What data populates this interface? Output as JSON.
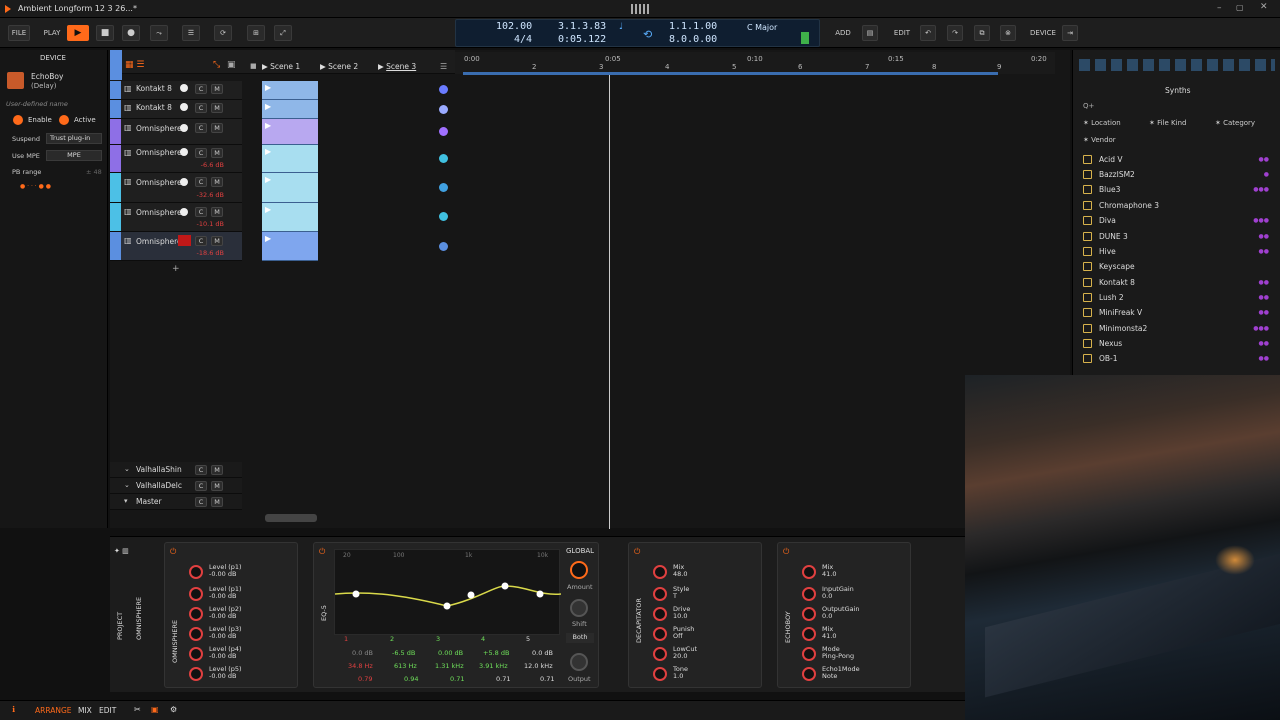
{
  "title": "Ambient Longform 12 3 26...*",
  "toolbar": {
    "file": "FILE",
    "play": "PLAY",
    "add": "ADD",
    "edit": "EDIT",
    "device": "DEVICE"
  },
  "transport": {
    "tempo": "102.00",
    "signature": "4/4",
    "position": "3.1.3.83",
    "time": "0:05.122",
    "loop_start": "1.1.1.00",
    "loop_end": "8.0.0.00",
    "key": "C Major"
  },
  "device_panel": {
    "header": "DEVICE",
    "plugin_name": "EchoBoy",
    "plugin_sub": "(Delay)",
    "user_defined": "User-defined name",
    "enable": "Enable",
    "active": "Active",
    "suspend_label": "Suspend",
    "suspend_value": "Trust plug-in",
    "use_mpe_label": "Use MPE",
    "use_mpe_value": "MPE",
    "pb_range_label": "PB range",
    "pb_range_value": "± 48"
  },
  "scenes": [
    "Scene 1",
    "Scene 2",
    "Scene 3"
  ],
  "tracks": [
    {
      "name": "Kontakt 8",
      "db": ""
    },
    {
      "name": "Kontakt 8",
      "db": ""
    },
    {
      "name": "Omnisphere",
      "db": ""
    },
    {
      "name": "Omnisphere",
      "db": "-6.6 dB"
    },
    {
      "name": "Omnisphere",
      "db": "-32.6 dB"
    },
    {
      "name": "Omnisphere",
      "db": "-10.1 dB"
    },
    {
      "name": "Omnisphere",
      "db": "-18.6 dB"
    }
  ],
  "fx_tracks": [
    {
      "name": "ValhallaShin"
    },
    {
      "name": "ValhallaDelc"
    },
    {
      "name": "Master"
    }
  ],
  "track_buttons": {
    "c": "C",
    "m": "M"
  },
  "ruler": [
    "0:00",
    "2",
    "3",
    "0:05",
    "4",
    "5",
    "0:10",
    "6",
    "7",
    "0:15",
    "8",
    "9",
    "0:20"
  ],
  "browser": {
    "title": "Synths",
    "search": "Q+",
    "location": "Location",
    "file_kind": "File Kind",
    "category": "Category",
    "vendor": "Vendor",
    "items": [
      "Acid V",
      "BazzISM2",
      "Blue3",
      "Chromaphone 3",
      "Diva",
      "DUNE 3",
      "Hive",
      "Keyscape",
      "Kontakt 8",
      "Lush 2",
      "MiniFreak V",
      "Minimonsta2",
      "Nexus",
      "OB-1"
    ]
  },
  "devices": {
    "project": "PROJECT",
    "omnisphere": "OMNISPHERE",
    "omni_params": [
      {
        "name": "Level (p1)",
        "value": "-0.00 dB"
      },
      {
        "name": "Level (p1)",
        "value": "-0.00 dB"
      },
      {
        "name": "Level (p2)",
        "value": "-0.00 dB"
      },
      {
        "name": "Level (p3)",
        "value": "-0.00 dB"
      },
      {
        "name": "Level (p4)",
        "value": "-0.00 dB"
      },
      {
        "name": "Level (p5)",
        "value": "-0.00 dB"
      }
    ],
    "eq": "EQ-5",
    "global": "GLOBAL",
    "amount": "Amount",
    "shift": "Shift",
    "both": "Both",
    "output": "Output",
    "eq_freq_labels": [
      "20",
      "100",
      "1k",
      "10k"
    ],
    "eq_bands": [
      {
        "num": "1",
        "gain": "0.0 dB",
        "freq": "34.8 Hz",
        "q": "0.79"
      },
      {
        "num": "2",
        "gain": "-6.5 dB",
        "freq": "613 Hz",
        "q": "0.94"
      },
      {
        "num": "3",
        "gain": "0.00 dB",
        "freq": "1.31 kHz",
        "q": "0.71"
      },
      {
        "num": "4",
        "gain": "+5.8 dB",
        "freq": "3.91 kHz",
        "q": "0.71"
      },
      {
        "num": "5",
        "gain": "0.0 dB",
        "freq": "12.0 kHz",
        "q": "0.71"
      }
    ],
    "decapitator": "DECAPITATOR",
    "deca_params": [
      {
        "name": "Mix",
        "value": "48.0"
      },
      {
        "name": "Style",
        "value": "T"
      },
      {
        "name": "Drive",
        "value": "10.0"
      },
      {
        "name": "Punish",
        "value": "Off"
      },
      {
        "name": "LowCut",
        "value": "20.0"
      },
      {
        "name": "Tone",
        "value": "1.0"
      }
    ],
    "echoboy": "ECHOBOY",
    "echo_params": [
      {
        "name": "Mix",
        "value": "41.0"
      },
      {
        "name": "InputGain",
        "value": "0.0"
      },
      {
        "name": "OutputGain",
        "value": "0.0"
      },
      {
        "name": "Mix",
        "value": "41.0"
      },
      {
        "name": "Mode",
        "value": "Ping-Pong"
      },
      {
        "name": "Echo1Mode",
        "value": "Note"
      }
    ]
  },
  "bottom": {
    "arrange": "ARRANGE",
    "mix": "MIX",
    "edit": "EDIT"
  },
  "colors": {
    "accent": "#ff6a1a",
    "clip": "#8fb7e8",
    "track_blue": "#5b8fe0",
    "track_purple": "#8e6fe6",
    "track_cyan": "#4cc0e6"
  }
}
